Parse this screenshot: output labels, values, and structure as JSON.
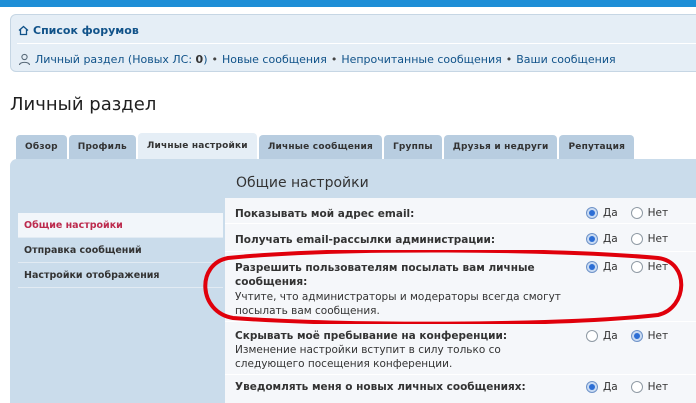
{
  "nav": {
    "forum_list": "Список форумов",
    "ucp_link": "Личный раздел (Новых ЛС: ",
    "new_pm_count": "0",
    "ucp_link_end": ")",
    "separator": "•",
    "new_posts": "Новые сообщения",
    "unread_posts": "Непрочитанные сообщения",
    "your_posts": "Ваши сообщения"
  },
  "page_title": "Личный раздел",
  "tabs": [
    {
      "label": "Обзор",
      "active": false
    },
    {
      "label": "Профиль",
      "active": false
    },
    {
      "label": "Личные настройки",
      "active": true
    },
    {
      "label": "Личные сообщения",
      "active": false
    },
    {
      "label": "Группы",
      "active": false
    },
    {
      "label": "Друзья и недруги",
      "active": false
    },
    {
      "label": "Репутация",
      "active": false
    }
  ],
  "side_menu": [
    {
      "label": "Общие настройки",
      "active": true
    },
    {
      "label": "Отправка сообщений",
      "active": false
    },
    {
      "label": "Настройки отображения",
      "active": false
    }
  ],
  "section_title": "Общие настройки",
  "radio_yes": "Да",
  "radio_no": "Нет",
  "settings": [
    {
      "label": "Показывать мой адрес email:",
      "description": "",
      "value": "yes"
    },
    {
      "label": "Получать email-рассылки администрации:",
      "description": "",
      "value": "yes"
    },
    {
      "label": "Разрешить пользователям посылать вам личные сообщения:",
      "description": "Учтите, что администраторы и модераторы всегда смогут посылать вам сообщения.",
      "value": "yes"
    },
    {
      "label": "Скрывать моё пребывание на конференции:",
      "description": "Изменение настройки вступит в силу только со следующего посещения конференции.",
      "value": "no"
    },
    {
      "label": "Уведомлять меня о новых личных сообщениях:",
      "description": "",
      "value": "yes"
    }
  ],
  "colors": {
    "accent": "#105289",
    "active_menu": "#bc2a4d",
    "highlight_ellipse": "#e0000b"
  }
}
